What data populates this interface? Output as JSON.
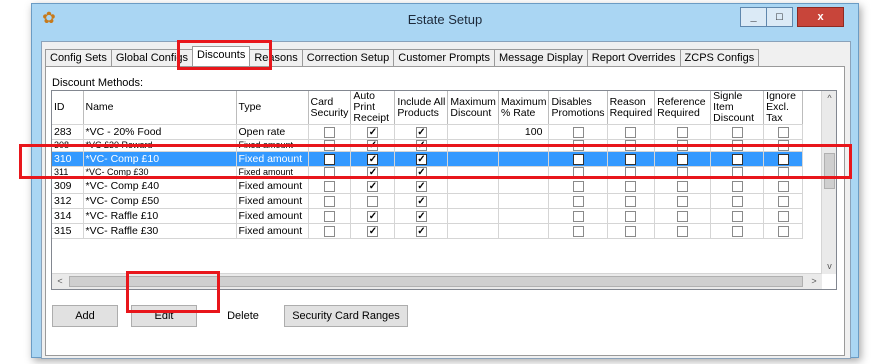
{
  "window": {
    "title": "Estate Setup",
    "minimize": "_",
    "maximize": "□",
    "close": "x"
  },
  "tabs": [
    "Config Sets",
    "Global Configs",
    "Discounts",
    "Reasons",
    "Correction Setup",
    "Customer Prompts",
    "Message Display",
    "Report Overrides",
    "ZCPS Configs"
  ],
  "active_tab": "Discounts",
  "section_label": "Discount Methods:",
  "columns": [
    "ID",
    "Name",
    "Type",
    "Card Security",
    "Auto Print Receipt",
    "Include All Products",
    "Maximum Discount",
    "Maximum % Rate",
    "Disables Promotions",
    "Reason Required",
    "Reference Required",
    "Signle Item Discount",
    "Ignore Excl. Tax"
  ],
  "rows": [
    {
      "id": "283",
      "name": "*VC - 20% Food",
      "type": "Open rate",
      "card_security": false,
      "auto_print": true,
      "include_all": true,
      "max_discount": "",
      "max_rate": "100",
      "disables_promotions": false,
      "reason_required": false,
      "reference_required": false,
      "single_item": false,
      "ignore_excl_tax": false,
      "selected": false,
      "partial": false
    },
    {
      "id": "308",
      "name": "*VC £30 Reward",
      "type": "Fixed amount",
      "card_security": false,
      "auto_print": true,
      "include_all": true,
      "max_discount": "",
      "max_rate": "",
      "disables_promotions": false,
      "reason_required": false,
      "reference_required": false,
      "single_item": false,
      "ignore_excl_tax": false,
      "selected": false,
      "partial": true
    },
    {
      "id": "310",
      "name": "*VC- Comp £10",
      "type": "Fixed amount",
      "card_security": false,
      "auto_print": true,
      "include_all": true,
      "max_discount": "",
      "max_rate": "",
      "disables_promotions": false,
      "reason_required": false,
      "reference_required": false,
      "single_item": false,
      "ignore_excl_tax": false,
      "selected": true,
      "partial": false
    },
    {
      "id": "311",
      "name": "*VC- Comp £30",
      "type": "Fixed amount",
      "card_security": false,
      "auto_print": true,
      "include_all": true,
      "max_discount": "",
      "max_rate": "",
      "disables_promotions": false,
      "reason_required": false,
      "reference_required": false,
      "single_item": false,
      "ignore_excl_tax": false,
      "selected": false,
      "partial": true
    },
    {
      "id": "309",
      "name": "*VC- Comp £40",
      "type": "Fixed amount",
      "card_security": false,
      "auto_print": true,
      "include_all": true,
      "max_discount": "",
      "max_rate": "",
      "disables_promotions": false,
      "reason_required": false,
      "reference_required": false,
      "single_item": false,
      "ignore_excl_tax": false,
      "selected": false,
      "partial": false
    },
    {
      "id": "312",
      "name": "*VC- Comp £50",
      "type": "Fixed amount",
      "card_security": false,
      "auto_print": false,
      "include_all": true,
      "max_discount": "",
      "max_rate": "",
      "disables_promotions": false,
      "reason_required": false,
      "reference_required": false,
      "single_item": false,
      "ignore_excl_tax": false,
      "selected": false,
      "partial": false
    },
    {
      "id": "314",
      "name": "*VC- Raffle £10",
      "type": "Fixed amount",
      "card_security": false,
      "auto_print": true,
      "include_all": true,
      "max_discount": "",
      "max_rate": "",
      "disables_promotions": false,
      "reason_required": false,
      "reference_required": false,
      "single_item": false,
      "ignore_excl_tax": false,
      "selected": false,
      "partial": false
    },
    {
      "id": "315",
      "name": "*VC- Raffle £30",
      "type": "Fixed amount",
      "card_security": false,
      "auto_print": true,
      "include_all": true,
      "max_discount": "",
      "max_rate": "",
      "disables_promotions": false,
      "reason_required": false,
      "reference_required": false,
      "single_item": false,
      "ignore_excl_tax": false,
      "selected": false,
      "partial": false
    }
  ],
  "scroll": {
    "up": "^",
    "down": "v",
    "left": "<",
    "right": ">"
  },
  "buttons": {
    "add": "Add",
    "edit": "Edit",
    "delete": "Delete",
    "security": "Security Card Ranges"
  },
  "colors": {
    "selection": "#3399ff",
    "highlight": "#e8161b",
    "title_bar": "#aad6f3"
  },
  "icons": {
    "app": "app-icon",
    "checkbox_checked": "checkmark-icon"
  }
}
